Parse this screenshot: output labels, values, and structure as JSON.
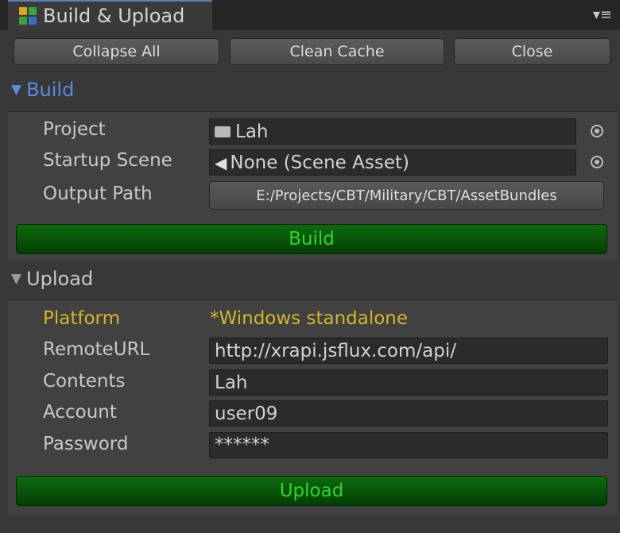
{
  "window": {
    "title": "Build & Upload",
    "icon": "editor-window-icon",
    "menu_icon": "context-menu-icon"
  },
  "toolbar": {
    "collapse_all": "Collapse All",
    "clean_cache": "Clean Cache",
    "close": "Close"
  },
  "build": {
    "header": "Build",
    "expanded": true,
    "project_label": "Project",
    "project_value": "Lah",
    "startup_scene_label": "Startup Scene",
    "startup_scene_value": "None (Scene Asset)",
    "output_path_label": "Output Path",
    "output_path_value": "E:/Projects/CBT/Military/CBT/AssetBundles",
    "build_button": "Build"
  },
  "upload": {
    "header": "Upload",
    "expanded": true,
    "platform_label": "Platform",
    "platform_value": "*Windows standalone",
    "remote_url_label": "RemoteURL",
    "remote_url_value": "http://xrapi.jsflux.com/api/",
    "contents_label": "Contents",
    "contents_value": "Lah",
    "account_label": "Account",
    "account_value": "user09",
    "password_label": "Password",
    "password_value": "******",
    "upload_button": "Upload"
  },
  "colors": {
    "accent_blue": "#5b8ae0",
    "warning_yellow": "#d4b62a",
    "button_green": "#0b5e0b",
    "button_text_green": "#2fd42f"
  }
}
